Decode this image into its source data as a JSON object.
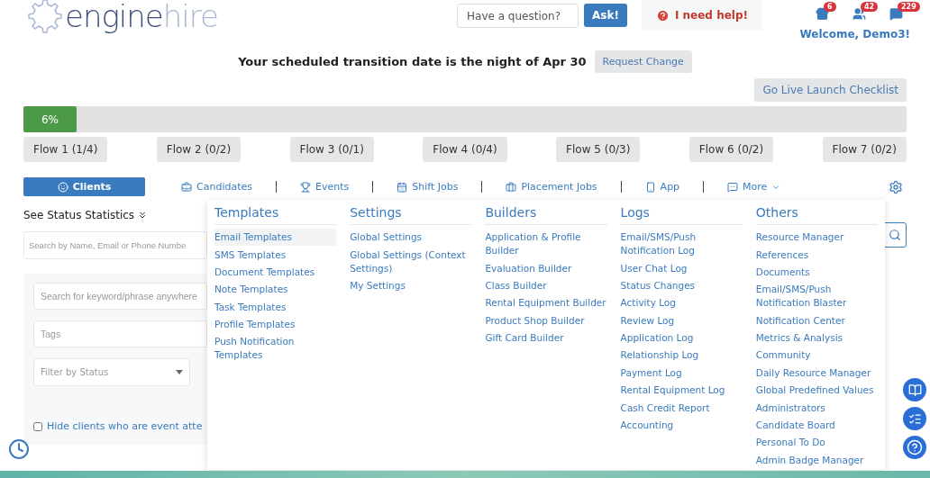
{
  "header": {
    "logo": {
      "primary": "engine",
      "secondary": "hire"
    },
    "question": {
      "placeholder": "Have a question?"
    },
    "ask_button": "Ask!",
    "help_button": "I need help!",
    "badges": [
      {
        "kind": "store",
        "count": "6"
      },
      {
        "kind": "people",
        "count": "42"
      },
      {
        "kind": "chat",
        "count": "229"
      }
    ],
    "welcome": "Welcome, Demo3!"
  },
  "transition": {
    "message": "Your scheduled transition date is the night of Apr 30",
    "button": "Request Change"
  },
  "go_live_button": "Go Live Launch Checklist",
  "progress": {
    "level": 0.06,
    "label": "6%"
  },
  "flows": [
    "Flow 1 (1/4)",
    "Flow 2 (0/2)",
    "Flow 3 (0/1)",
    "Flow 4 (0/4)",
    "Flow 5 (0/3)",
    "Flow 6 (0/2)",
    "Flow 7 (0/2)"
  ],
  "tabs": [
    {
      "label": "Clients",
      "kind": "clients",
      "selected": true
    },
    {
      "label": "Candidates",
      "kind": "candidates",
      "selected": false
    },
    {
      "label": "Events",
      "kind": "events",
      "selected": false
    },
    {
      "label": "Shift Jobs",
      "kind": "shifts",
      "selected": false
    },
    {
      "label": "Placement Jobs",
      "kind": "placement",
      "selected": false
    },
    {
      "label": "App",
      "kind": "app",
      "selected": false
    },
    {
      "label": "More",
      "kind": "more",
      "selected": false
    }
  ],
  "sidebar": {
    "status_toggle": "See Status Statistics",
    "search": {
      "placeholder": "Search by Name, Email or Phone Numbe"
    },
    "keyword": {
      "placeholder": "Search for keyword/phrase anywhere"
    },
    "tags": {
      "placeholder": "Tags"
    },
    "status_filter": {
      "placeholder": "Filter by Status"
    },
    "hide_checkbox": {
      "label": "Hide clients who are event atte",
      "checked": false
    }
  },
  "menu": {
    "columns": [
      {
        "title": "Templates",
        "items": [
          {
            "label": "Email Templates",
            "selected": true
          },
          {
            "label": "SMS Templates",
            "selected": false
          },
          {
            "label": "Document Templates",
            "selected": false
          },
          {
            "label": "Note Templates",
            "selected": false
          },
          {
            "label": "Task Templates",
            "selected": false
          },
          {
            "label": "Profile Templates",
            "selected": false
          },
          {
            "label": "Push Notification Templates",
            "selected": false
          }
        ]
      },
      {
        "title": "Settings",
        "items": [
          {
            "label": "Global Settings",
            "selected": false
          },
          {
            "label": "Global Settings (Context Settings)",
            "selected": false
          },
          {
            "label": "My Settings",
            "selected": false
          }
        ]
      },
      {
        "title": "Builders",
        "items": [
          {
            "label": "Application & Profile Builder",
            "selected": false
          },
          {
            "label": "Evaluation Builder",
            "selected": false
          },
          {
            "label": "Class Builder",
            "selected": false
          },
          {
            "label": "Rental Equipment Builder",
            "selected": false
          },
          {
            "label": "Product Shop Builder",
            "selected": false
          },
          {
            "label": "Gift Card Builder",
            "selected": false
          }
        ]
      },
      {
        "title": "Logs",
        "items": [
          {
            "label": "Email/SMS/Push Notification Log",
            "selected": false
          },
          {
            "label": "User Chat Log",
            "selected": false
          },
          {
            "label": "Status Changes",
            "selected": false
          },
          {
            "label": "Activity Log",
            "selected": false
          },
          {
            "label": "Review Log",
            "selected": false
          },
          {
            "label": "Application Log",
            "selected": false
          },
          {
            "label": "Relationship Log",
            "selected": false
          },
          {
            "label": "Payment Log",
            "selected": false
          },
          {
            "label": "Rental Equipment Log",
            "selected": false
          },
          {
            "label": "Cash Credit Report",
            "selected": false
          },
          {
            "label": "Accounting",
            "selected": false
          }
        ]
      },
      {
        "title": "Others",
        "items": [
          {
            "label": "Resource Manager",
            "selected": false
          },
          {
            "label": "References",
            "selected": false
          },
          {
            "label": "Documents",
            "selected": false
          },
          {
            "label": "Email/SMS/Push Notification Blaster",
            "selected": false
          },
          {
            "label": "Notification Center",
            "selected": false
          },
          {
            "label": "Metrics & Analysis",
            "selected": false
          },
          {
            "label": "Community",
            "selected": false
          },
          {
            "label": "Daily Resource Manager",
            "selected": false
          },
          {
            "label": "Global Predefined Values",
            "selected": false
          },
          {
            "label": "Administrators",
            "selected": false
          },
          {
            "label": "Candidate Board",
            "selected": false
          },
          {
            "label": "Personal To Do",
            "selected": false
          },
          {
            "label": "Admin Badge Manager",
            "selected": false
          }
        ]
      }
    ]
  }
}
